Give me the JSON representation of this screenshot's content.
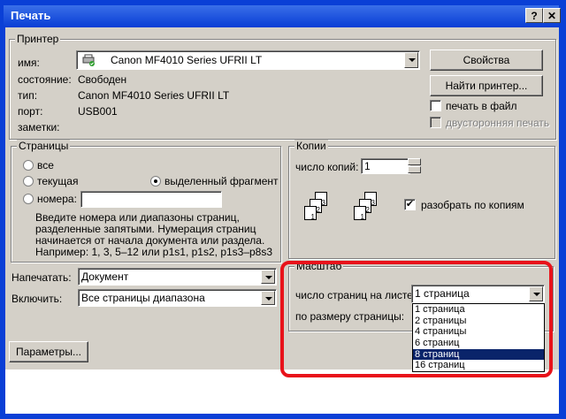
{
  "window": {
    "title": "Печать",
    "help_label": "?",
    "close_label": "✕"
  },
  "printer": {
    "legend": "Принтер",
    "name_label": "имя:",
    "name_value": "Canon MF4010 Series UFRII LT",
    "status_label": "состояние:",
    "status_value": "Свободен",
    "type_label": "тип:",
    "type_value": "Canon MF4010 Series UFRII LT",
    "port_label": "порт:",
    "port_value": "USB001",
    "notes_label": "заметки:",
    "properties_button": "Свойства",
    "find_button": "Найти принтер...",
    "print_to_file": "печать в файл",
    "duplex": "двусторонняя печать"
  },
  "pages": {
    "legend": "Страницы",
    "all": "все",
    "current": "текущая",
    "selection": "выделенный фрагмент",
    "numbers": "номера:",
    "hint": [
      "Введите номера или диапазоны страниц,",
      "разделенные запятыми. Нумерация страниц",
      "начинается от начала документа или раздела.",
      "Например: 1, 3, 5–12 или p1s1, p1s2, p1s3–p8s3"
    ]
  },
  "print_what": {
    "label": "Напечатать:",
    "value": "Документ"
  },
  "include": {
    "label": "Включить:",
    "value": "Все страницы диапазона"
  },
  "copies": {
    "legend": "Копии",
    "count_label": "число копий:",
    "count_value": "1",
    "collate": "разобрать по копиям",
    "page_numbers": [
      "1",
      "2",
      "3"
    ]
  },
  "zoom": {
    "legend": "Масштаб",
    "pages_per_sheet_label": "число страниц на листе:",
    "pages_per_sheet_value": "1 страница",
    "scale_label": "по размеру страницы:",
    "options": [
      "1 страница",
      "2 страницы",
      "4 страницы",
      "6 страниц",
      "8 страниц",
      "16 страниц"
    ],
    "selected_index": 4
  },
  "params_button": "Параметры..."
}
